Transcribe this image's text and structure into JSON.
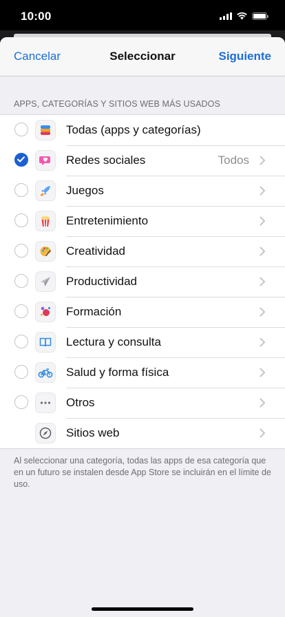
{
  "status": {
    "time": "10:00"
  },
  "nav": {
    "cancel": "Cancelar",
    "title": "Seleccionar",
    "next": "Siguiente"
  },
  "section_header": "APPS, CATEGORÍAS Y SITIOS WEB MÁS USADOS",
  "items": [
    {
      "label": "Todas (apps y categorías)",
      "icon": "layers-icon",
      "checked": false,
      "detail": "",
      "chevron": false,
      "radio": true
    },
    {
      "label": "Redes sociales",
      "icon": "chat-heart-icon",
      "checked": true,
      "detail": "Todos",
      "chevron": true,
      "radio": true
    },
    {
      "label": "Juegos",
      "icon": "rocket-icon",
      "checked": false,
      "detail": "",
      "chevron": true,
      "radio": true
    },
    {
      "label": "Entretenimiento",
      "icon": "popcorn-icon",
      "checked": false,
      "detail": "",
      "chevron": true,
      "radio": true
    },
    {
      "label": "Creatividad",
      "icon": "palette-icon",
      "checked": false,
      "detail": "",
      "chevron": true,
      "radio": true
    },
    {
      "label": "Productividad",
      "icon": "paper-plane-icon",
      "checked": false,
      "detail": "",
      "chevron": true,
      "radio": true
    },
    {
      "label": "Formación",
      "icon": "planet-icon",
      "checked": false,
      "detail": "",
      "chevron": true,
      "radio": true
    },
    {
      "label": "Lectura y consulta",
      "icon": "book-icon",
      "checked": false,
      "detail": "",
      "chevron": true,
      "radio": true
    },
    {
      "label": "Salud y forma física",
      "icon": "bicycle-icon",
      "checked": false,
      "detail": "",
      "chevron": true,
      "radio": true
    },
    {
      "label": "Otros",
      "icon": "more-dots-icon",
      "checked": false,
      "detail": "",
      "chevron": true,
      "radio": true
    },
    {
      "label": "Sitios web",
      "icon": "compass-icon",
      "checked": false,
      "detail": "",
      "chevron": true,
      "radio": false
    }
  ],
  "footer": "Al seleccionar una categoría, todas las apps de esa categoría que en un futuro se instalen desde App Store se incluirán en el límite de uso.",
  "colors": {
    "accent": "#1a6fd9",
    "checked": "#1a60d2",
    "background": "#efeff4"
  }
}
